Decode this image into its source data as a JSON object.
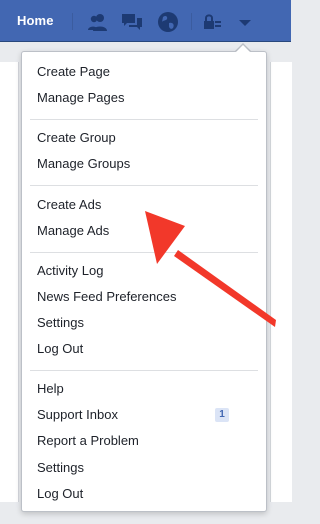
{
  "topbar": {
    "home_label": "Home",
    "icons": [
      "friend-requests-icon",
      "messages-icon",
      "notifications-globe-icon",
      "privacy-lock-icon",
      "account-menu-arrow-icon"
    ],
    "bg_color": "#4267b2"
  },
  "menu": {
    "sections": [
      {
        "items": [
          "Create Page",
          "Manage Pages"
        ]
      },
      {
        "items": [
          "Create Group",
          "Manage Groups"
        ]
      },
      {
        "items": [
          "Create Ads",
          "Manage Ads"
        ]
      },
      {
        "items": [
          "Activity Log",
          "News Feed Preferences",
          "Settings",
          "Log Out"
        ]
      },
      {
        "items": [
          "Help",
          "Support Inbox",
          "Report a Problem",
          "Settings",
          "Log Out"
        ]
      }
    ],
    "support_inbox_badge": "1"
  },
  "annotation": {
    "arrow_color": "#f2382a",
    "points_to": "Manage Ads"
  }
}
